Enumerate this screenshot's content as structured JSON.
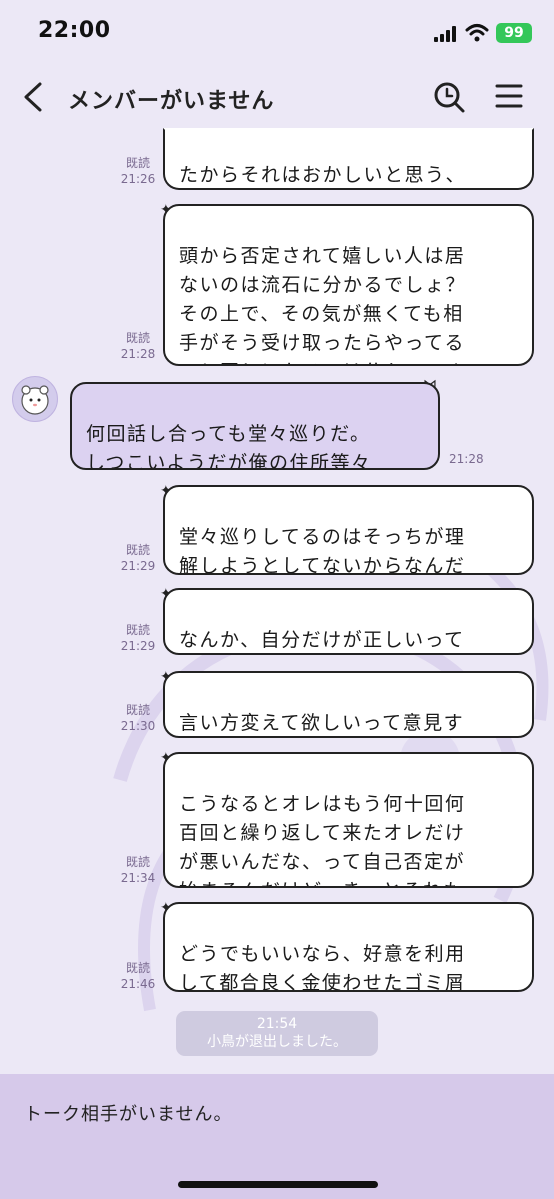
{
  "status_bar": {
    "time": "22:00",
    "battery": "99"
  },
  "header": {
    "title": "メンバーがいません"
  },
  "messages": [
    {
      "read": "既読",
      "time": "21:26",
      "text": "たからそれはおかしいと思う、\nって意見"
    },
    {
      "read": "既読",
      "time": "21:28",
      "text": "頭から否定されて嬉しい人は居\nないのは流石に分かるでしょ？\nその上で、その気が無くても相\n手がそう受け取ったらやってる\nのと同じになるのは分かってく\nれる？"
    },
    {
      "time": "21:28",
      "text": "何回話し合っても堂々巡りだ。\nしつこいようだが俺の住所等々\nは抹消しといてくれ。"
    },
    {
      "read": "既読",
      "time": "21:29",
      "text": "堂々巡りしてるのはそっちが理\n解しようとしてないからなんだ\nけどな"
    },
    {
      "read": "既読",
      "time": "21:29",
      "text": "なんか、自分だけが正しいって\n考え方なのかなって思っちゃう"
    },
    {
      "read": "既読",
      "time": "21:30",
      "text": "言い方変えて欲しいって意見す\nらも受け入れて貰えないし"
    },
    {
      "read": "既読",
      "time": "21:34",
      "text": "こうなるとオレはもう何十回何\n百回と繰り返して来たオレだけ\nが悪いんだな、って自己否定が\n始まるんだけど、きっとそれも\nどうでもいいのかな、"
    },
    {
      "read": "既読",
      "time": "21:46",
      "text": "どうでもいいなら、好意を利用\nして都合良く金使わせたゴミ屑\nだとでも思って忘れて良いよ、"
    }
  ],
  "system": {
    "time": "21:54",
    "text": "小鳥が退出しました。"
  },
  "footer": {
    "text": "トーク相手がいません。"
  }
}
